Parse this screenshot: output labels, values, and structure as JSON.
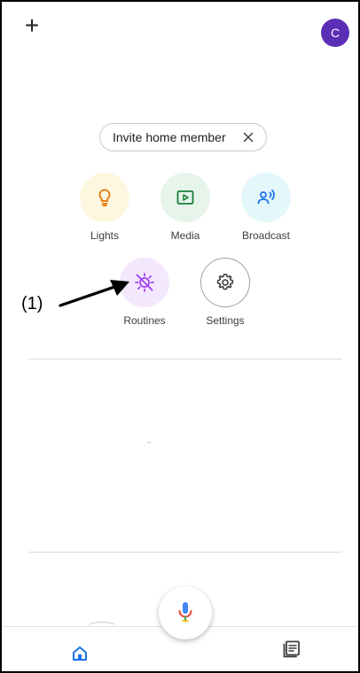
{
  "header": {
    "add_label": "+",
    "avatar_initial": "C",
    "avatar_color": "#5a2fb5"
  },
  "invite_chip": {
    "label": "Invite home member",
    "close_icon": "close-icon"
  },
  "tiles": [
    {
      "label": "Lights",
      "icon": "lightbulb-icon",
      "bg": "#fef7e0",
      "fg": "#e37400"
    },
    {
      "label": "Media",
      "icon": "play-box-icon",
      "bg": "#e6f4ea",
      "fg": "#188038"
    },
    {
      "label": "Broadcast",
      "icon": "broadcast-icon",
      "bg": "#e4f7fb",
      "fg": "#1a73e8"
    },
    {
      "label": "Routines",
      "icon": "routines-sun-icon",
      "bg": "#f3e8fd",
      "fg": "#a142f4"
    },
    {
      "label": "Settings",
      "icon": "gear-icon",
      "bg": "#ffffff",
      "fg": "#3c4043"
    }
  ],
  "annotation": {
    "label": "(1)"
  },
  "faded_text": "( ,",
  "voice": {
    "icon": "microphone-icon"
  },
  "bottom_nav": {
    "home_icon": "home-icon",
    "feed_icon": "feed-icon",
    "accent": "#1a73e8"
  }
}
